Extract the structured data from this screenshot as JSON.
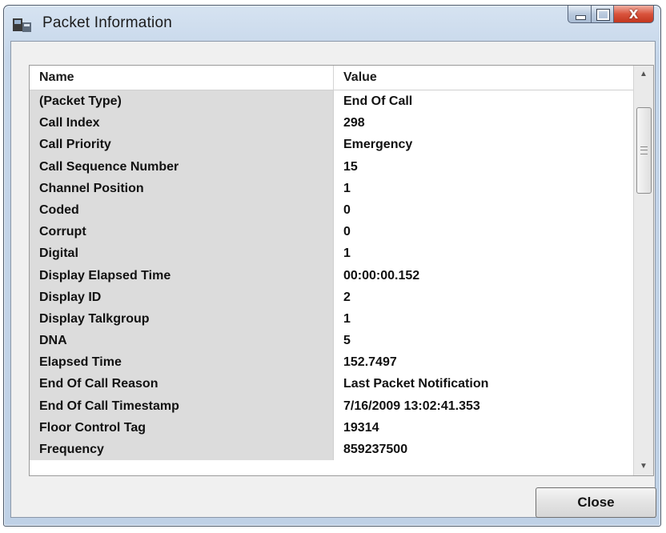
{
  "window": {
    "title": "Packet Information",
    "close_glyph": "X"
  },
  "grid": {
    "columns": {
      "name": "Name",
      "value": "Value"
    },
    "rows": [
      {
        "name": "(Packet Type)",
        "value": "End Of Call"
      },
      {
        "name": "Call Index",
        "value": "298"
      },
      {
        "name": "Call Priority",
        "value": "Emergency"
      },
      {
        "name": "Call Sequence Number",
        "value": "15"
      },
      {
        "name": "Channel Position",
        "value": "1"
      },
      {
        "name": "Coded",
        "value": "0"
      },
      {
        "name": "Corrupt",
        "value": "0"
      },
      {
        "name": "Digital",
        "value": "1"
      },
      {
        "name": "Display Elapsed Time",
        "value": "00:00:00.152"
      },
      {
        "name": "Display ID",
        "value": "2"
      },
      {
        "name": "Display Talkgroup",
        "value": "1"
      },
      {
        "name": "DNA",
        "value": "5"
      },
      {
        "name": "Elapsed Time",
        "value": "152.7497"
      },
      {
        "name": "End Of Call Reason",
        "value": "Last Packet Notification"
      },
      {
        "name": "End Of Call Timestamp",
        "value": "7/16/2009 13:02:41.353"
      },
      {
        "name": "Floor Control Tag",
        "value": "19314"
      },
      {
        "name": "Frequency",
        "value": "859237500"
      }
    ]
  },
  "buttons": {
    "close_label": "Close"
  },
  "icons": {
    "app": "packet-info-icon",
    "scroll_up": "scroll-up-arrow-icon",
    "scroll_down": "scroll-down-arrow-icon"
  }
}
